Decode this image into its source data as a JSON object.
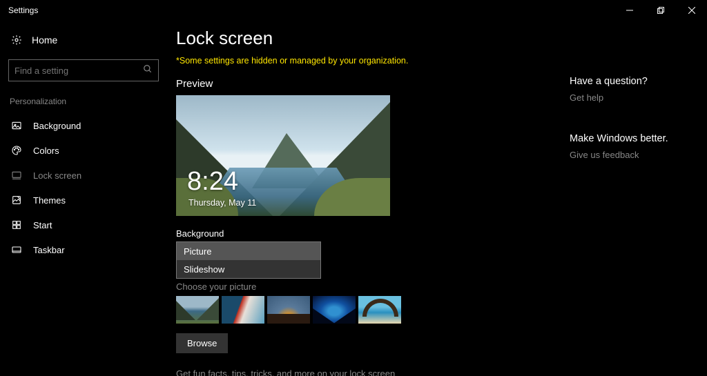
{
  "titlebar": {
    "title": "Settings"
  },
  "sidebar": {
    "home_label": "Home",
    "search_placeholder": "Find a setting",
    "section_label": "Personalization",
    "items": [
      {
        "label": "Background"
      },
      {
        "label": "Colors"
      },
      {
        "label": "Lock screen"
      },
      {
        "label": "Themes"
      },
      {
        "label": "Start"
      },
      {
        "label": "Taskbar"
      }
    ]
  },
  "main": {
    "page_title": "Lock screen",
    "warning": "*Some settings are hidden or managed by your organization.",
    "preview_head": "Preview",
    "preview_time": "8:24",
    "preview_date": "Thursday, May 11",
    "background_label": "Background",
    "dropdown": {
      "options": [
        "Picture",
        "Slideshow"
      ],
      "selected": "Picture"
    },
    "choose_label": "Choose your picture",
    "browse_label": "Browse",
    "funfacts_label": "Get fun facts, tips, tricks, and more on your lock screen"
  },
  "right": {
    "q_head": "Have a question?",
    "q_link": "Get help",
    "f_head": "Make Windows better.",
    "f_link": "Give us feedback"
  }
}
